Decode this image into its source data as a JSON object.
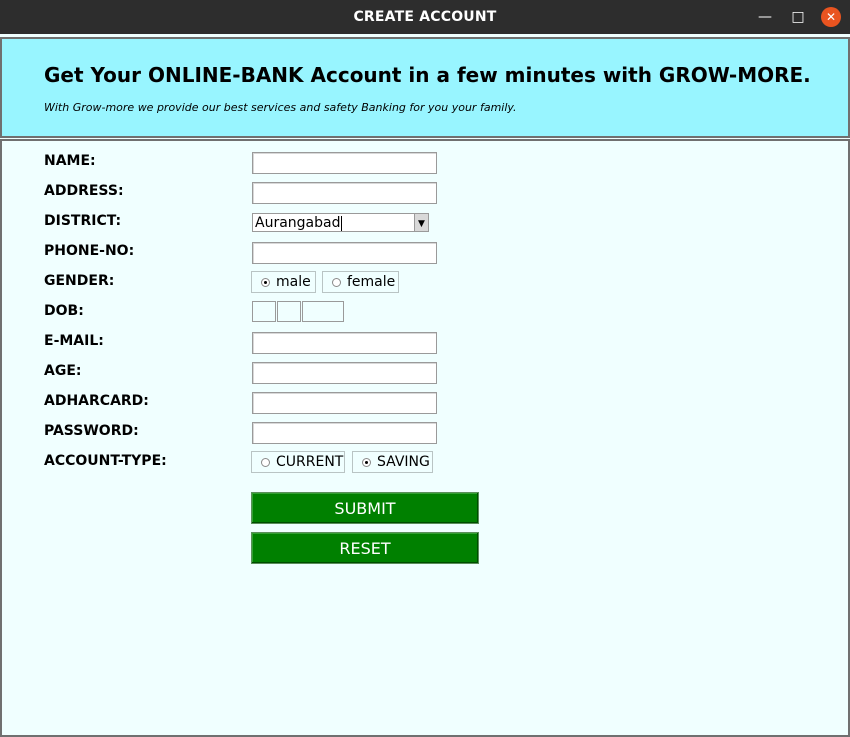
{
  "window": {
    "title": "CREATE ACCOUNT",
    "min_icon": "minimize-icon",
    "max_icon": "maximize-icon",
    "close_icon": "close-icon"
  },
  "header": {
    "headline": "Get Your ONLINE-BANK Account in a few minutes with GROW-MORE.",
    "tagline": "With Grow-more we provide our best services and safety Banking for you your family."
  },
  "form": {
    "name_label": "NAME:",
    "address_label": "ADDRESS:",
    "district_label": "DISTRICT:",
    "district_value": "Aurangabad",
    "phone_label": "PHONE-NO:",
    "gender_label": "GENDER:",
    "gender_options": [
      "male",
      "female"
    ],
    "gender_selected": "male",
    "dob_label": "DOB:",
    "email_label": "E-MAIL:",
    "age_label": "AGE:",
    "adhar_label": "ADHARCARD:",
    "password_label": "PASSWORD:",
    "account_type_label": "ACCOUNT-TYPE:",
    "account_options": [
      "CURRENT",
      "SAVING"
    ],
    "account_selected": "SAVING",
    "submit_label": "SUBMIT",
    "reset_label": "RESET"
  },
  "colors": {
    "titlebar": "#2d2d2d",
    "header_bg": "#98f5ff",
    "body_bg": "#f0ffff",
    "button_bg": "#008000",
    "close_btn": "#e95420"
  }
}
